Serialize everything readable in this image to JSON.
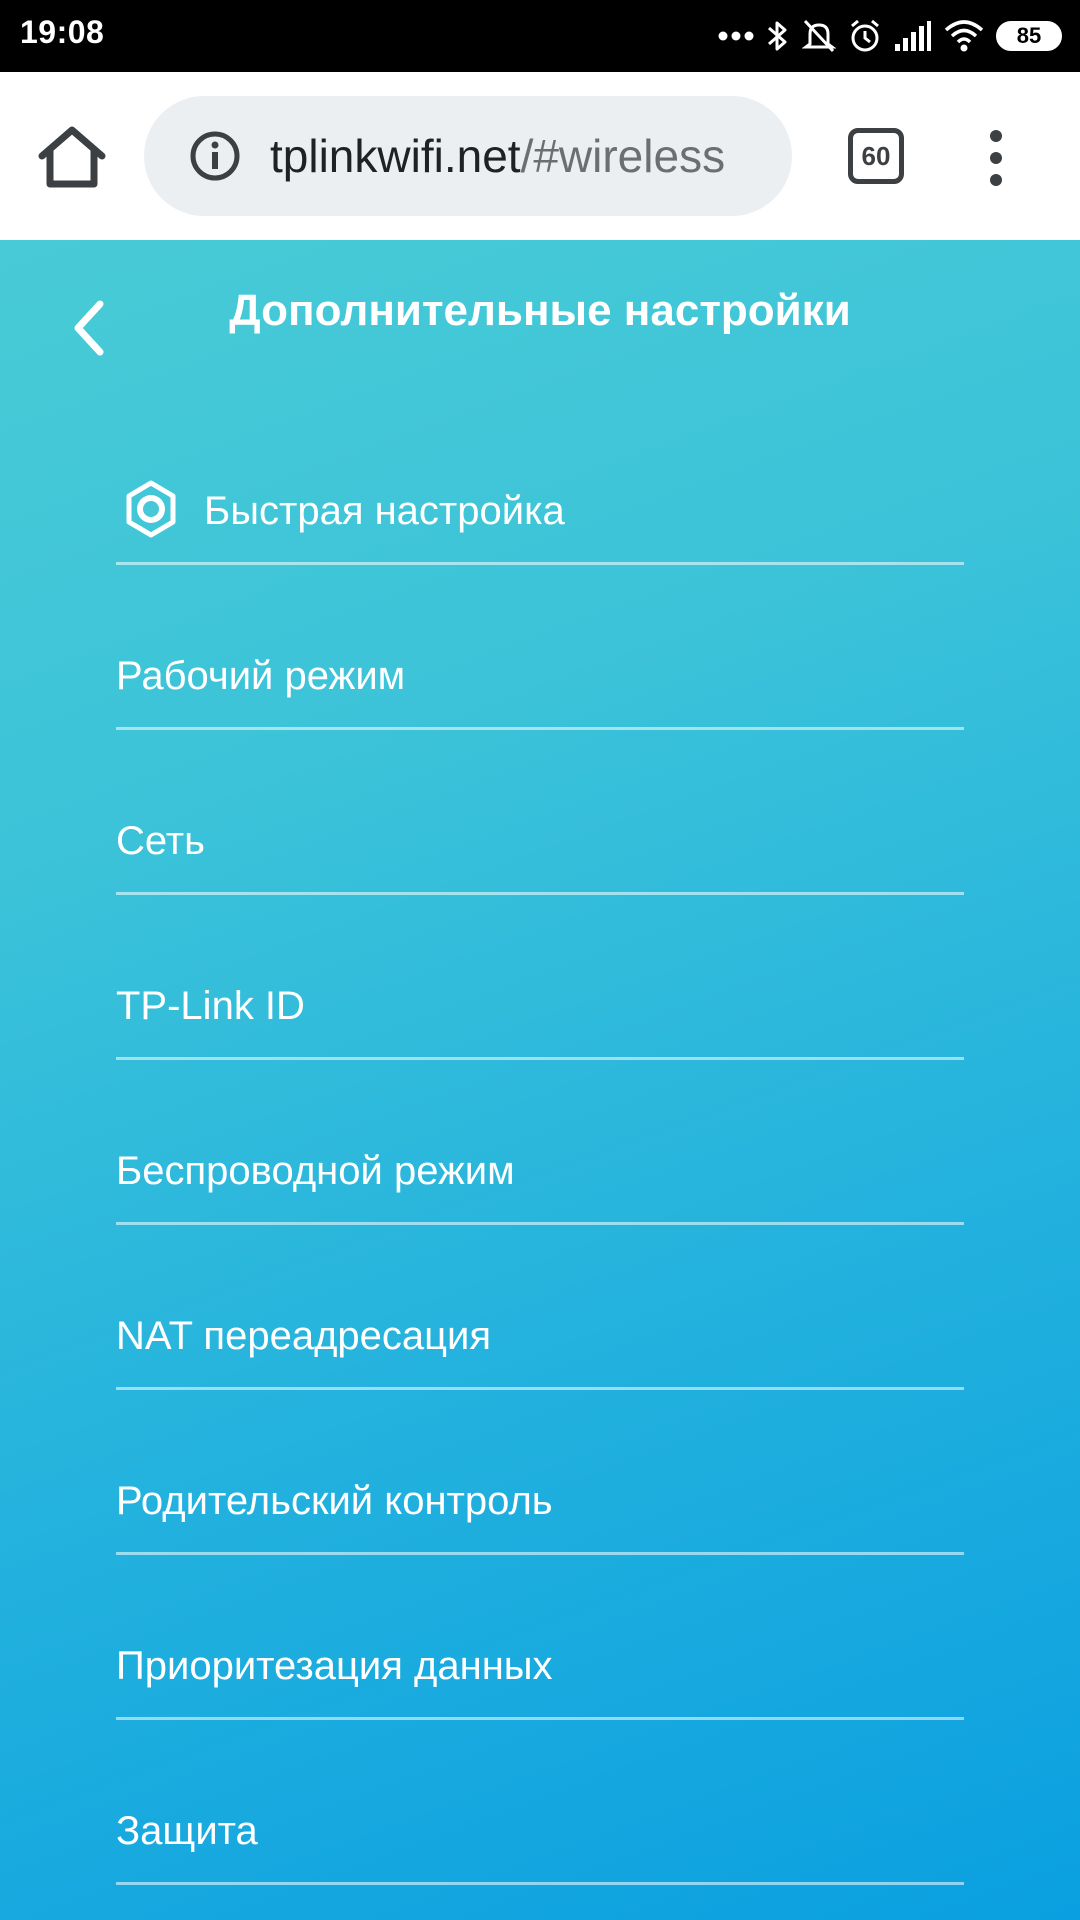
{
  "status_bar": {
    "time": "19:08",
    "battery": "85"
  },
  "browser": {
    "url_host": "tplinkwifi.net",
    "url_path": "/#wireless",
    "tab_count": "60"
  },
  "page": {
    "title": "Дополнительные настройки",
    "menu_items": [
      {
        "label": "Быстрая настройка",
        "icon": "gear-icon"
      },
      {
        "label": "Рабочий режим"
      },
      {
        "label": "Сеть"
      },
      {
        "label": "TP-Link ID"
      },
      {
        "label": "Беспроводной режим"
      },
      {
        "label": "NAT переадресация"
      },
      {
        "label": "Родительский контроль"
      },
      {
        "label": "Приоритезация данных"
      },
      {
        "label": "Защита"
      }
    ]
  },
  "colors": {
    "gradient_top": "#48cbd6",
    "gradient_bottom": "#0a9fe0",
    "status_bar": "#000000",
    "url_box": "#eceff1"
  }
}
